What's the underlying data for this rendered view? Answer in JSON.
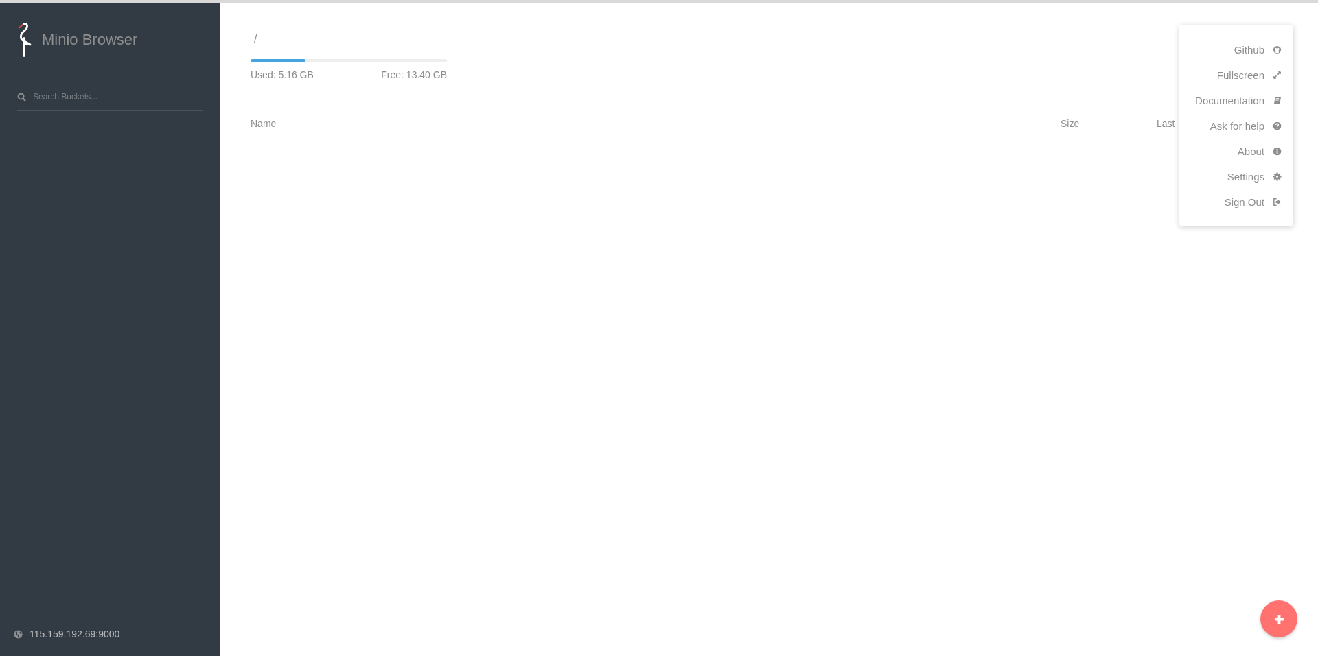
{
  "sidebar": {
    "title": "Minio Browser",
    "search": {
      "placeholder": "Search Buckets..."
    },
    "host": "115.159.192.69:9000"
  },
  "main": {
    "path": "/",
    "storage": {
      "level": 0.28,
      "used": "Used: 5.16 GB",
      "free": "Free: 13.40 GB"
    },
    "table": {
      "columns": [
        "Name",
        "Size",
        "Last"
      ]
    }
  },
  "menu": {
    "items": [
      {
        "label": "Github"
      },
      {
        "label": "Fullscreen"
      },
      {
        "label": "Documentation"
      },
      {
        "label": "Ask for help"
      },
      {
        "label": "About"
      },
      {
        "label": "Settings"
      },
      {
        "label": "Sign Out"
      }
    ]
  }
}
